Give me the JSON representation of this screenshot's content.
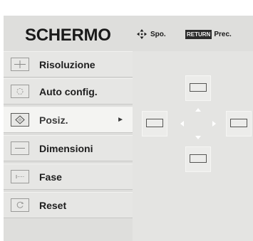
{
  "header": {
    "title": "SCHERMO",
    "move_label": "Spo.",
    "return_key": "RETURN",
    "prev_label": "Prec."
  },
  "menu": {
    "items": [
      {
        "label": "Risoluzione",
        "icon": "resolution-icon"
      },
      {
        "label": "Auto config.",
        "icon": "auto-config-icon"
      },
      {
        "label": "Posiz.",
        "icon": "position-icon",
        "selected": true
      },
      {
        "label": "Dimensioni",
        "icon": "size-icon"
      },
      {
        "label": "Fase",
        "icon": "phase-icon"
      },
      {
        "label": "Reset",
        "icon": "reset-icon"
      }
    ],
    "selected_arrow": "►"
  },
  "colors": {
    "background": "#dededc",
    "selected_item": "#f4f4f2",
    "text": "#1e1e1e",
    "return_key_bg": "#2b2b2b"
  }
}
